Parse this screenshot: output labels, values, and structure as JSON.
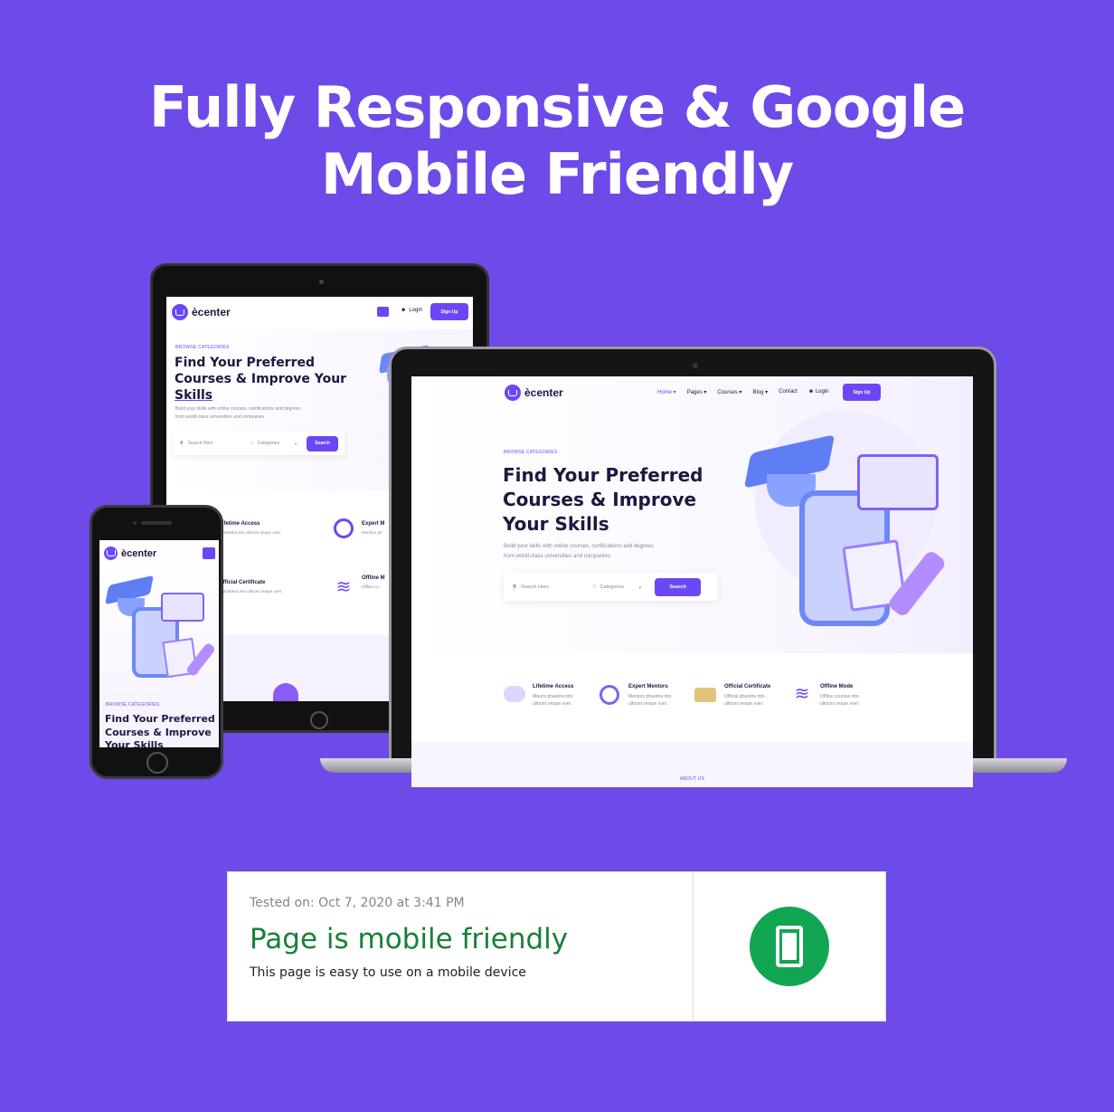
{
  "headline": {
    "line1": "Fully Responsive & Google",
    "line2": "Mobile Friendly"
  },
  "site": {
    "logo_text": "ècenter",
    "nav": [
      "Home",
      "Pages",
      "Courses",
      "Blog",
      "Contact"
    ],
    "login": "Login",
    "signup": "Sign Up",
    "kicker": "BROWSE CATEGORIES",
    "hero_line1": "Find Your Preferred",
    "hero_line2": "Courses & Improve",
    "hero_line3": "Your Skills",
    "tablet_line1": "Find Your Preferred",
    "tablet_line2": "Courses & Improve Your",
    "tablet_line3": "Skills",
    "hero_sub1": "Build your skills with online courses, certifications and degrees",
    "hero_sub2": "from world-class universities and companies.",
    "search_placeholder": "Search Here",
    "categories_placeholder": "Categories",
    "search_btn": "Search",
    "features": [
      {
        "title": "Lifetime Access",
        "desc1": "Mauris pharetra into",
        "desc2": "ultrices neque over."
      },
      {
        "title": "Expert Mentors",
        "desc1": "Mentors pharetra into",
        "desc2": "ultrices neque over."
      },
      {
        "title": "Official Certificate",
        "desc1": "Official pharetra into",
        "desc2": "ultrices neque over."
      },
      {
        "title": "Offline Mode",
        "desc1": "Offline courses into",
        "desc2": "ultrices neque over."
      }
    ],
    "tablet_features": [
      {
        "title": "Lifetime Access",
        "desc": "s pharetra into ultrices neque over."
      },
      {
        "title": "Expert M",
        "desc": "Mentors ph"
      },
      {
        "title": "Official Certificate",
        "desc": "al pharetra into ultrices neque over."
      },
      {
        "title": "Offline M",
        "desc": "Offline co"
      }
    ],
    "about": "ABOUT US"
  },
  "report": {
    "tested_on": "Tested on: Oct 7, 2020 at 3:41 PM",
    "verdict": "Page is mobile friendly",
    "detail": "This page is easy to use on a mobile device"
  },
  "colors": {
    "background": "#6e4ae8",
    "accent": "#6c47f5",
    "verdict_green": "#188038",
    "icon_green": "#12a552"
  }
}
